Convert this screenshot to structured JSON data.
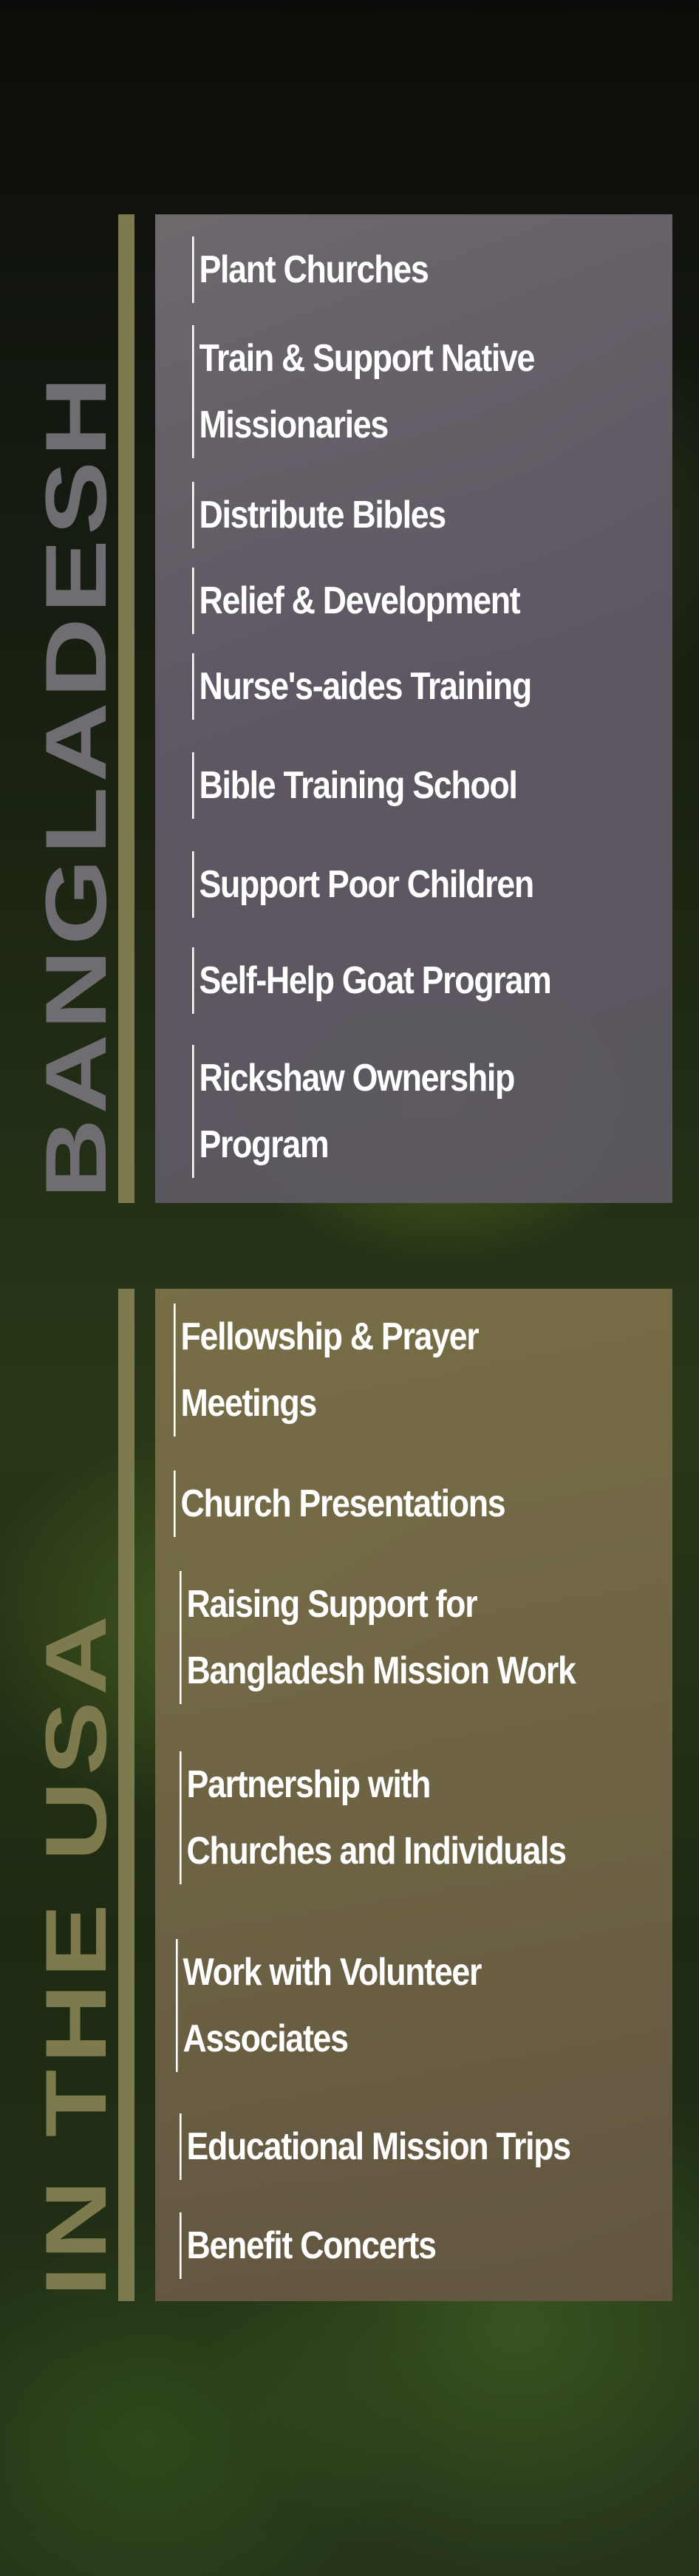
{
  "sections": {
    "bangladesh": {
      "title": "BANGLADESH",
      "items": [
        {
          "lines": [
            "Plant Churches"
          ]
        },
        {
          "lines": [
            "Train & Support Native",
            "Missionaries"
          ]
        },
        {
          "lines": [
            "Distribute Bibles"
          ]
        },
        {
          "lines": [
            "Relief & Development"
          ]
        },
        {
          "lines": [
            "Nurse's-aides Training"
          ]
        },
        {
          "lines": [
            "Bible Training School"
          ]
        },
        {
          "lines": [
            "Support Poor Children"
          ]
        },
        {
          "lines": [
            "Self-Help Goat Program"
          ]
        },
        {
          "lines": [
            "Rickshaw Ownership",
            "Program"
          ]
        }
      ]
    },
    "usa": {
      "title": "IN THE USA",
      "items": [
        {
          "lines": [
            "Fellowship & Prayer",
            "Meetings"
          ]
        },
        {
          "lines": [
            "Church Presentations"
          ]
        },
        {
          "lines": [
            "Raising Support for",
            "Bangladesh Mission Work"
          ]
        },
        {
          "lines": [
            "Partnership with",
            "Churches and Individuals"
          ]
        },
        {
          "lines": [
            "Work with Volunteer",
            "Associates"
          ]
        },
        {
          "lines": [
            "Educational Mission Trips"
          ]
        },
        {
          "lines": [
            "Benefit Concerts"
          ]
        }
      ]
    }
  },
  "colors": {
    "bangladesh_title": "#6f6d72",
    "usa_title": "#7d7a4e",
    "bar": "#7d7a4e",
    "text": "#ffffff"
  }
}
